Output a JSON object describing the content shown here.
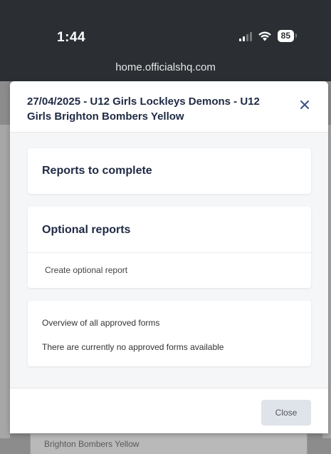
{
  "status_bar": {
    "time": "1:44",
    "battery": "85"
  },
  "browser": {
    "url": "home.officialshq.com"
  },
  "modal": {
    "title": "27/04/2025 - U12 Girls Lockleys Demons - U12 Girls Brighton Bombers Yellow",
    "close_icon": "close-icon",
    "sections": {
      "reports_to_complete": {
        "heading": "Reports to complete"
      },
      "optional_reports": {
        "heading": "Optional reports",
        "link": "Create optional report"
      },
      "approved_forms": {
        "title": "Overview of all approved forms",
        "empty_message": "There are currently no approved forms available"
      }
    },
    "footer": {
      "close_label": "Close"
    }
  },
  "background": {
    "footer_text": "Brighton Bombers Yellow"
  },
  "colors": {
    "status_bar_bg": "#2b2f33",
    "heading_text": "#1f2a44",
    "close_icon": "#3a4f8a",
    "close_button_bg": "#dfe3ea",
    "overlay": "#8c8c8c"
  }
}
